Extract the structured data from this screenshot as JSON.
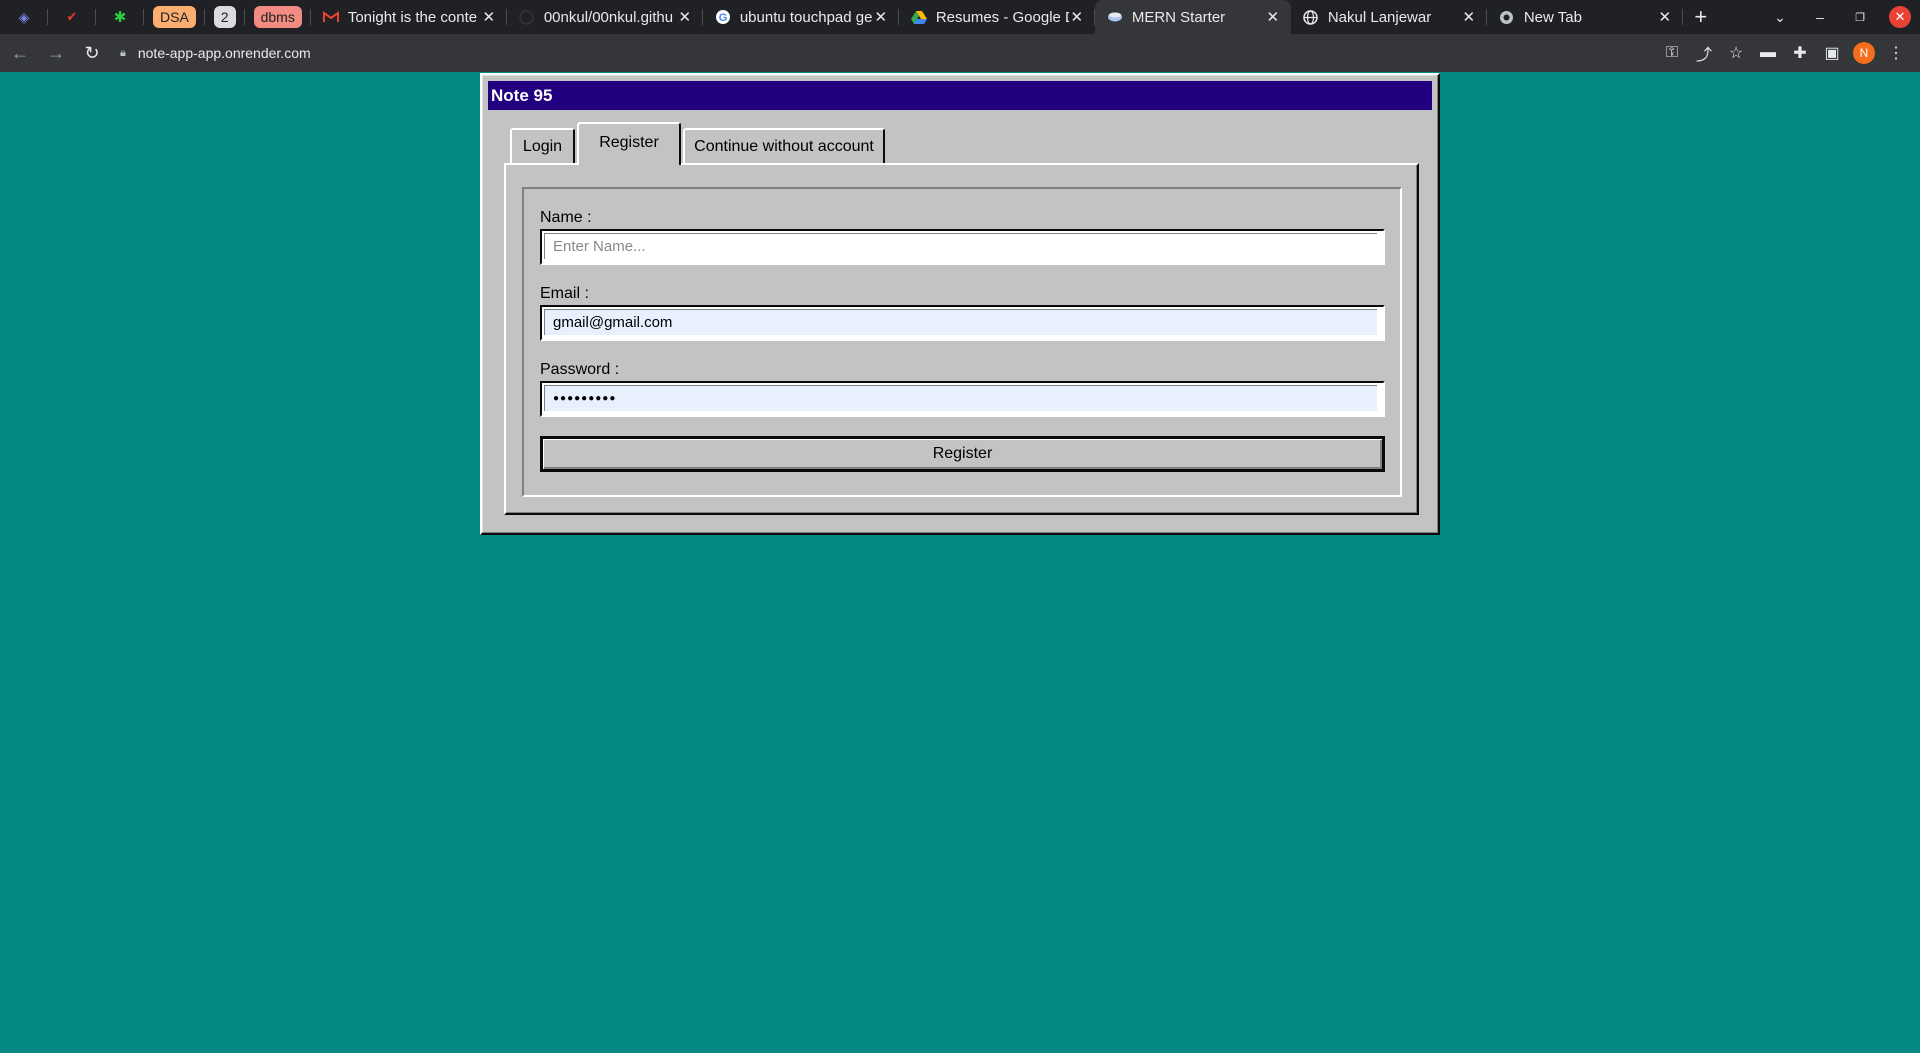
{
  "browser": {
    "pinned": [
      {
        "name": "pinned-tab-1",
        "glyph": "◈",
        "color": "#7b7fe6"
      },
      {
        "name": "pinned-tab-2",
        "glyph": "✔",
        "color": "#e53935"
      },
      {
        "name": "pinned-tab-3",
        "glyph": "✱",
        "color": "#2ecc40"
      }
    ],
    "groups": [
      {
        "label": "DSA",
        "color": "#fcad70"
      },
      {
        "label": "2",
        "color": "#dadce0"
      },
      {
        "label": "dbms",
        "color": "#f28b82"
      }
    ],
    "tabs": [
      {
        "title": "Tonight is the conte",
        "icon": "gmail-icon"
      },
      {
        "title": "00nkul/00nkul.githu",
        "icon": "github-icon"
      },
      {
        "title": "ubuntu touchpad ge",
        "icon": "google-icon"
      },
      {
        "title": "Resumes - Google D",
        "icon": "google-drive-icon"
      },
      {
        "title": "MERN Starter",
        "icon": "react-icon",
        "active": true
      },
      {
        "title": "Nakul Lanjewar",
        "icon": "globe-icon"
      },
      {
        "title": "New Tab",
        "icon": "chrome-icon"
      }
    ],
    "url": "note-app-app.onrender.com",
    "profile_initial": "N"
  },
  "app": {
    "title": "Note 95",
    "tabs": {
      "login": "Login",
      "register": "Register",
      "guest": "Continue without account"
    },
    "form": {
      "name_label": "Name :",
      "name_placeholder": "Enter Name...",
      "name_value": "",
      "email_label": "Email :",
      "email_value": "gmail@gmail.com",
      "password_label": "Password :",
      "password_value": "●●●●●●●●●",
      "submit_label": "Register"
    }
  },
  "colors": {
    "desktop": "#038884",
    "titlebar": "#22007f",
    "window": "#c3c3c3"
  }
}
